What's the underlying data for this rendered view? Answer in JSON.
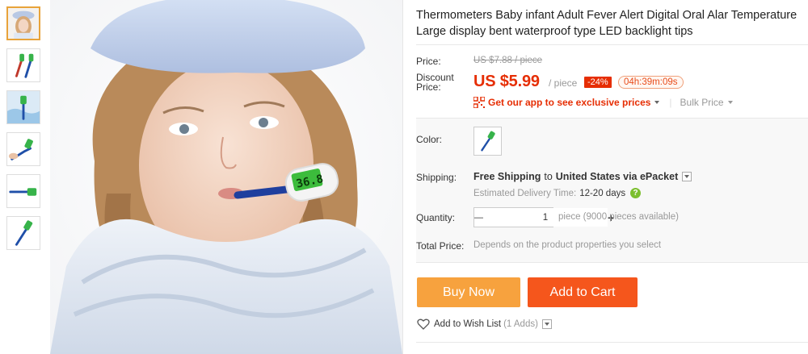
{
  "product": {
    "title": "Thermometers Baby infant Adult Fever Alert Digital Oral Alar Temperature Large display bent waterproof type LED backlight tips",
    "image_alt": "Child with thermometer",
    "thermometer_display": "36.8"
  },
  "price": {
    "label": "Price:",
    "original": "US $7.88 / piece",
    "discount_label": "Discount Price:",
    "discount_value": "US $5.99",
    "per_piece": "/ piece",
    "discount_badge": "-24%",
    "timer": "04h:39m:09s"
  },
  "app_promo": {
    "text": "Get our app to see exclusive prices",
    "bulk_price": "Bulk Price"
  },
  "color": {
    "label": "Color:"
  },
  "shipping": {
    "label": "Shipping:",
    "free_text": "Free Shipping",
    "to_text": "to",
    "destination": "United States via ePacket",
    "est_label": "Estimated Delivery Time:",
    "est_days": "12-20 days",
    "help": "?"
  },
  "quantity": {
    "label": "Quantity:",
    "minus": "—",
    "value": "1",
    "plus": "+",
    "available": "piece (9000 pieces available)"
  },
  "total": {
    "label": "Total Price:",
    "text": "Depends on the product properties you select"
  },
  "actions": {
    "buy_now": "Buy Now",
    "add_to_cart": "Add to Cart",
    "wish_list": "Add to Wish List",
    "wish_count": "(1 Adds)"
  },
  "colors": {
    "accent_red": "#e62e04",
    "buy_orange": "#f7a23e",
    "cart_orange": "#f5561c",
    "thumb_active_border": "#e8a33a",
    "help_green": "#7cbf2f"
  }
}
